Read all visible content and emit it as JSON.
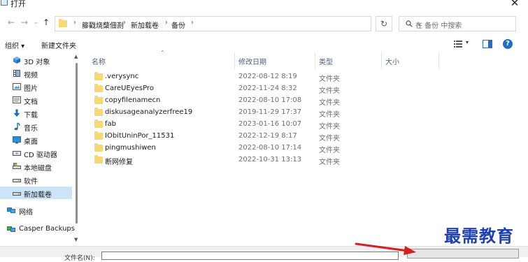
{
  "window": {
    "title": "打开",
    "close_label": "✕"
  },
  "navigation": {
    "back_label": "←",
    "forward_label": "→",
    "recent_label": "⌄",
    "up_label": "↑",
    "breadcrumbs": [
      "籐戳烧蘖佃剳",
      "新加载卷",
      "备份"
    ],
    "address_dropdown_label": "⌄",
    "refresh_label": "↻",
    "search_placeholder": "在 备份 中搜索"
  },
  "toolbar": {
    "organize_label": "组织 ▾",
    "new_folder_label": "新建文件夹",
    "view_dropdown_label": "▾",
    "help_label": "?"
  },
  "sidebar": {
    "items": [
      {
        "label": "3D 对象",
        "icon": "cube-icon"
      },
      {
        "label": "视频",
        "icon": "video-icon"
      },
      {
        "label": "图片",
        "icon": "picture-icon"
      },
      {
        "label": "文档",
        "icon": "document-icon"
      },
      {
        "label": "下载",
        "icon": "download-icon"
      },
      {
        "label": "音乐",
        "icon": "music-icon"
      },
      {
        "label": "桌面",
        "icon": "desktop-icon"
      },
      {
        "label": "CD 驱动器",
        "icon": "cd-drive-icon"
      },
      {
        "label": "本地磁盘",
        "icon": "local-disk-icon"
      },
      {
        "label": "软件",
        "icon": "drive-icon"
      },
      {
        "label": "新加载卷",
        "icon": "drive-icon",
        "selected": true
      },
      {
        "label": "网络",
        "icon": "network-icon"
      },
      {
        "label": "Casper Backups",
        "icon": "backup-icon"
      }
    ]
  },
  "file_list": {
    "columns": [
      "名称",
      "修改日期",
      "类型",
      "大小"
    ],
    "rows": [
      {
        "name": ".verysync",
        "date": "2022-08-12 8:19",
        "type": "文件夹"
      },
      {
        "name": "CareUEyesPro",
        "date": "2022-11-24 8:32",
        "type": "文件夹"
      },
      {
        "name": "copyfilenamecn",
        "date": "2022-08-10 17:08",
        "type": "文件夹"
      },
      {
        "name": "diskusageanalyzerfree19",
        "date": "2019-11-29 17:37",
        "type": "文件夹"
      },
      {
        "name": "fab",
        "date": "2023-01-16 10:07",
        "type": "文件夹"
      },
      {
        "name": "IObitUninPor_11531",
        "date": "2022-12-19 8:17",
        "type": "文件夹"
      },
      {
        "name": "pingmushiwen",
        "date": "2022-08-10 17:14",
        "type": "文件夹"
      },
      {
        "name": "断网修复",
        "date": "2022-10-31 13:13",
        "type": "文件夹"
      }
    ]
  },
  "footer": {
    "filename_label": "文件名(N):"
  },
  "watermark": {
    "text": "最需教育"
  },
  "colors": {
    "selection": "#cce4f7",
    "folder": "#f8d775",
    "watermark": "#1d3fb3",
    "annotation_arrow": "#d42020"
  }
}
